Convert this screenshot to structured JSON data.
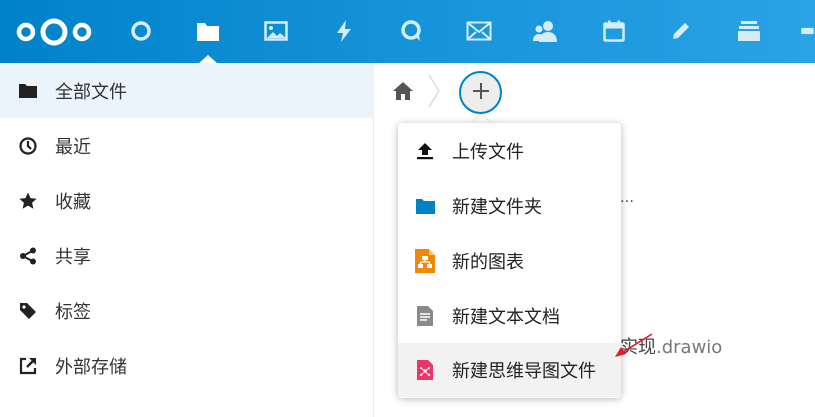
{
  "header": {
    "brand_color": "#0082c9",
    "apps": [
      "dashboard-icon",
      "files-icon",
      "photos-icon",
      "activity-icon",
      "talk-icon",
      "mail-icon",
      "contacts-icon",
      "calendar-icon",
      "notes-icon",
      "deck-icon",
      "more-icon"
    ],
    "active_app": "files-icon"
  },
  "sidebar": {
    "items": [
      {
        "label": "全部文件",
        "icon": "folder-icon"
      },
      {
        "label": "最近",
        "icon": "clock-icon"
      },
      {
        "label": "收藏",
        "icon": "star-icon"
      },
      {
        "label": "共享",
        "icon": "share-icon"
      },
      {
        "label": "标签",
        "icon": "tag-icon"
      },
      {
        "label": "外部存储",
        "icon": "external-link-icon"
      }
    ],
    "active_index": 0
  },
  "breadcrumb": {
    "home_icon": "home-icon",
    "add_icon": "plus-icon"
  },
  "background": {
    "partial_text_1": "…",
    "partial_text_2_main": "实现",
    "partial_text_2_ext": ".drawio"
  },
  "new_menu": {
    "items": [
      {
        "label": "上传文件",
        "icon": "upload-icon"
      },
      {
        "label": "新建文件夹",
        "icon": "folder-icon"
      },
      {
        "label": "新的图表",
        "icon": "diagram-icon"
      },
      {
        "label": "新建文本文档",
        "icon": "text-document-icon"
      },
      {
        "label": "新建思维导图文件",
        "icon": "mindmap-icon"
      }
    ],
    "hover_index": 4
  },
  "annotation": {
    "arrow_color": "#e02020"
  }
}
